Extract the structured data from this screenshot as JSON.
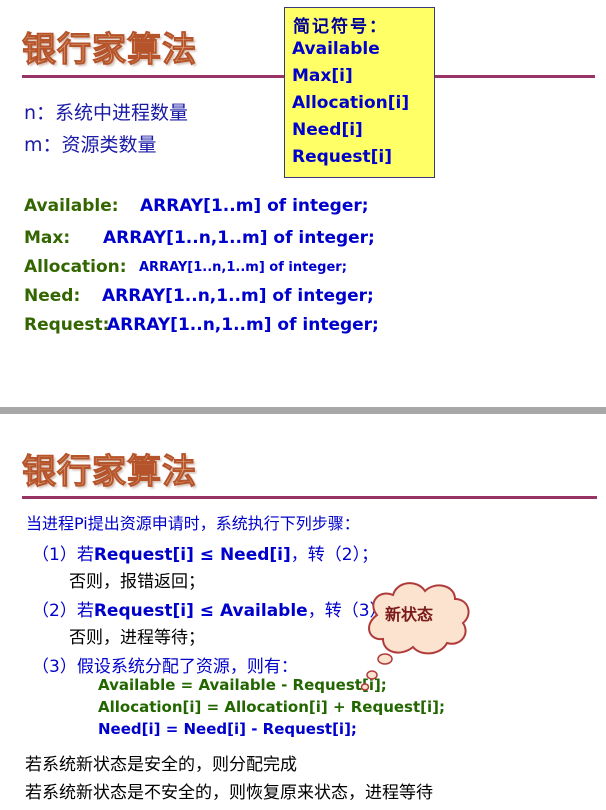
{
  "slide1": {
    "title": "银行家算法",
    "abbrev": {
      "heading": "简记符号：",
      "items": [
        "Available",
        "Max[i]",
        "Allocation[i]",
        "Need[i]",
        "Request[i]"
      ]
    },
    "n_line": "n：系统中进程数量",
    "m_line": "m：资源类数量",
    "declarations": [
      {
        "name": "Available:",
        "type": "ARRAY[1..m] of integer;"
      },
      {
        "name": "Max:",
        "type": "ARRAY[1..n,1..m] of integer;"
      },
      {
        "name": "Allocation:",
        "type": "ARRAY[1..n,1..m] of integer;"
      },
      {
        "name": "Need:",
        "type": "ARRAY[1..n,1..m] of integer;"
      },
      {
        "name": "Request:",
        "type": "ARRAY[1..n,1..m] of integer;"
      }
    ]
  },
  "slide2": {
    "title": "银行家算法",
    "intro": "当进程Pi提出资源申请时，系统执行下列步骤：",
    "step1": {
      "num": "（1）若",
      "cond": "Request[i] ≤ Need[i]",
      "rest": "，转（2）；",
      "else": "否则，报错返回；"
    },
    "step2": {
      "num": "（2）若",
      "cond": "Request[i] ≤ Available",
      "rest": "，转（3）；",
      "else": "否则，进程等待；"
    },
    "step3": {
      "head": "（3）假设系统分配了资源，则有："
    },
    "formulas": [
      "Available = Available - Request[i];",
      "Allocation[i] = Allocation[i] + Request[i];",
      "Need[i] = Need[i] - Request[i];"
    ],
    "bubble": "新状态",
    "conclusion1": "若系统新状态是安全的，则分配完成",
    "conclusion2": "若系统新状态是不安全的，则恢复原来状态，进程等待"
  }
}
